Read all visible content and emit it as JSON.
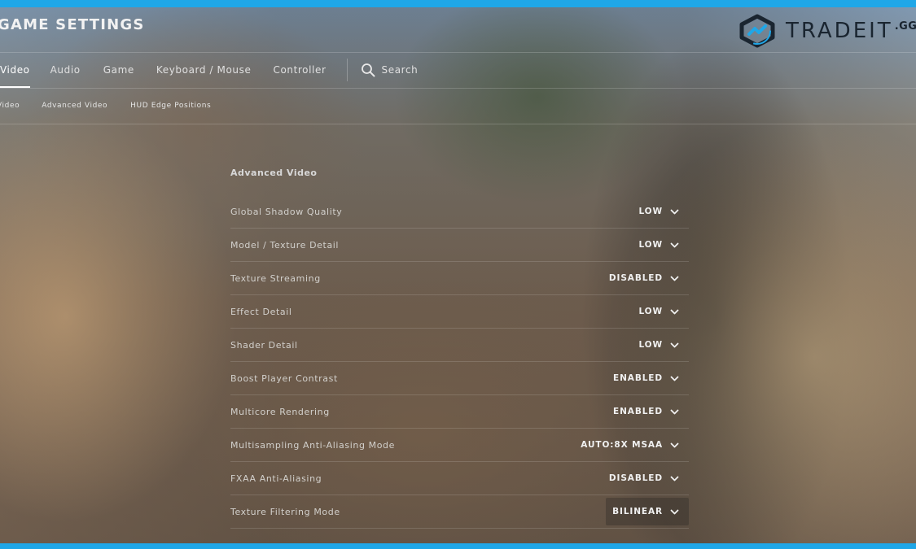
{
  "app": {
    "title": "GAME SETTINGS"
  },
  "brand": {
    "name": "TRADEIT",
    "suffix": ".GG"
  },
  "main_tabs": [
    {
      "label": "Video",
      "active": true
    },
    {
      "label": "Audio"
    },
    {
      "label": "Game"
    },
    {
      "label": "Keyboard / Mouse"
    },
    {
      "label": "Controller"
    }
  ],
  "search": {
    "label": "Search"
  },
  "sub_tabs": [
    {
      "label": "Video"
    },
    {
      "label": "Advanced Video"
    },
    {
      "label": "HUD Edge Positions"
    }
  ],
  "section": {
    "title": "Advanced Video"
  },
  "settings": [
    {
      "label": "Global Shadow Quality",
      "value": "LOW"
    },
    {
      "label": "Model / Texture Detail",
      "value": "LOW"
    },
    {
      "label": "Texture Streaming",
      "value": "DISABLED"
    },
    {
      "label": "Effect Detail",
      "value": "LOW"
    },
    {
      "label": "Shader Detail",
      "value": "LOW"
    },
    {
      "label": "Boost Player Contrast",
      "value": "ENABLED"
    },
    {
      "label": "Multicore Rendering",
      "value": "ENABLED"
    },
    {
      "label": "Multisampling Anti-Aliasing Mode",
      "value": "AUTO:8X MSAA"
    },
    {
      "label": "FXAA Anti-Aliasing",
      "value": "DISABLED"
    },
    {
      "label": "Texture Filtering Mode",
      "value": "BILINEAR"
    }
  ],
  "colors": {
    "accent_frame": "#1fa7e8",
    "logo_text": "#1a2530"
  },
  "icons": {
    "search": "search-icon",
    "dropdown": "chevron-down-icon",
    "logo": "tradeit-logo-icon"
  }
}
